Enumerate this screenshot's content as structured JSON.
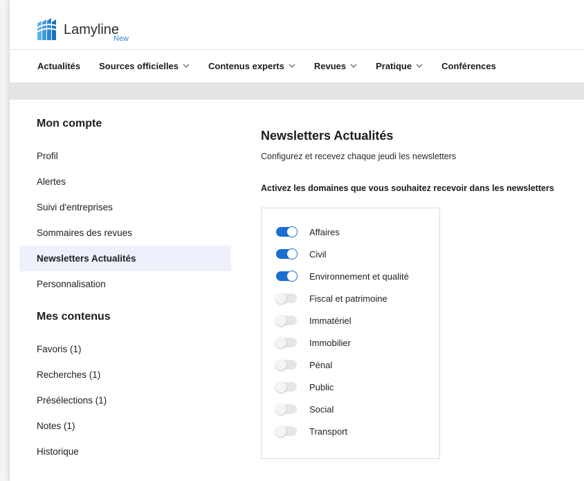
{
  "brand": {
    "name": "Lamyline",
    "sub": "New",
    "accent": "#2f89d6"
  },
  "nav": [
    {
      "label": "Actualités",
      "chevron": false
    },
    {
      "label": "Sources officielles",
      "chevron": true
    },
    {
      "label": "Contenus experts",
      "chevron": true
    },
    {
      "label": "Revues",
      "chevron": true
    },
    {
      "label": "Pratique",
      "chevron": true
    },
    {
      "label": "Conférences",
      "chevron": false
    }
  ],
  "sidebar": {
    "account_heading": "Mon compte",
    "account_items": [
      {
        "label": "Profil",
        "active": false
      },
      {
        "label": "Alertes",
        "active": false
      },
      {
        "label": "Suivi d'entreprises",
        "active": false
      },
      {
        "label": "Sommaires des revues",
        "active": false
      },
      {
        "label": "Newsletters Actualités",
        "active": true
      },
      {
        "label": "Personnalisation",
        "active": false
      }
    ],
    "content_heading": "Mes contenus",
    "content_items": [
      {
        "label": "Favoris (1)"
      },
      {
        "label": "Recherches (1)"
      },
      {
        "label": "Présélections (1)"
      },
      {
        "label": "Notes (1)"
      },
      {
        "label": "Historique"
      }
    ]
  },
  "main": {
    "title": "Newsletters Actualités",
    "description": "Configurez et recevez chaque jeudi les newsletters",
    "instruction": "Activez les domaines que vous souhaitez recevoir dans les newsletters",
    "domains": [
      {
        "label": "Affaires",
        "enabled": true
      },
      {
        "label": "Civil",
        "enabled": true
      },
      {
        "label": "Environnement et qualité",
        "enabled": true
      },
      {
        "label": "Fiscal et patrimoine",
        "enabled": false
      },
      {
        "label": "Immatériel",
        "enabled": false
      },
      {
        "label": "Immobilier",
        "enabled": false
      },
      {
        "label": "Pénal",
        "enabled": false
      },
      {
        "label": "Public",
        "enabled": false
      },
      {
        "label": "Social",
        "enabled": false
      },
      {
        "label": "Transport",
        "enabled": false
      }
    ]
  },
  "colors": {
    "toggle_on": "#1a6fd1",
    "active_item_bg": "#eef1fb"
  }
}
